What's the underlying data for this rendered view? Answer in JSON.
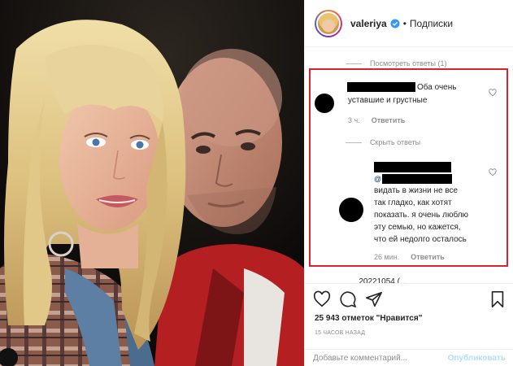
{
  "header": {
    "username": "valeriya",
    "separator": "•",
    "follow_label": "Подписки"
  },
  "comments": {
    "view_replies_label": "Посмотреть ответы (1)",
    "hide_replies_label": "Скрыть ответы",
    "first": {
      "text_line1": "Оба очень",
      "text_line2": "уставшие и грустные",
      "time": "3 ч.",
      "reply_label": "Ответить"
    },
    "second": {
      "mention_prefix": "@",
      "lines": [
        "видать в жизни не все",
        "так гладко, как хотят",
        "показать. я очень люблю",
        "эту семью, но кажется,",
        "что ей недолго осталось"
      ],
      "time": "26 мин.",
      "reply_label": "Ответить"
    },
    "cutoff_text": "...20221054 (..."
  },
  "actions": {
    "likes_text": "25 943 отметок \"Нравится\"",
    "time_ago": "15 ЧАСОВ НАЗАД",
    "comment_placeholder": "Добавьте комментарий...",
    "publish_label": "Опубликовать"
  },
  "colors": {
    "highlight": "#d9232f",
    "verified": "#3897f0",
    "muted": "#8e8e8e",
    "publish_disabled": "#b2dffc"
  }
}
